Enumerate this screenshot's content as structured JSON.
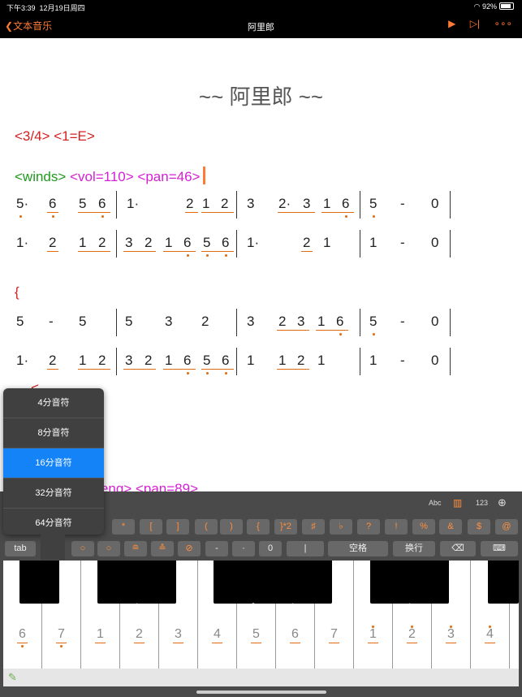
{
  "status": {
    "time": "下午3:39",
    "date": "12月19日周四",
    "battery": "92%",
    "wifi_icon": "wifi-icon"
  },
  "nav": {
    "back_label": "文本音乐",
    "title": "阿里郎",
    "play_icon": "▶",
    "step_icon": "▷|",
    "more_icon": "∘∘∘"
  },
  "sheet": {
    "title": "~~  阿里郎 ~~",
    "meta": "<3/4> <1=E>",
    "track1_name": "<winds>",
    "track1_params": "<vol=110> <pan=46>",
    "brace_open": "{",
    "track2_partial": "eng> <pan=89>",
    "track2_partial_prefix": "<",
    "track2_bracket_hint": "<"
  },
  "dropdown": {
    "items": [
      "4分音符",
      "8分音符",
      "16分音符",
      "32分音符",
      "64分音符"
    ],
    "selected": "16分音符"
  },
  "keyboard": {
    "abc": "Abc",
    "num": "123",
    "sym_row": [
      "*",
      "[",
      "]",
      "(",
      ")",
      "{",
      "}*2",
      "♯",
      "♭",
      "?",
      "!",
      "%",
      "&",
      "$",
      "@"
    ],
    "tab": "tab",
    "dash": "-",
    "dot": "·",
    "zero": "0",
    "bar": "|",
    "space": "空格",
    "enter": "换行"
  },
  "piano_labels": [
    "6",
    "7",
    "1",
    "2",
    "3",
    "4",
    "5",
    "6",
    "7",
    "1",
    "2",
    "3",
    "4"
  ]
}
